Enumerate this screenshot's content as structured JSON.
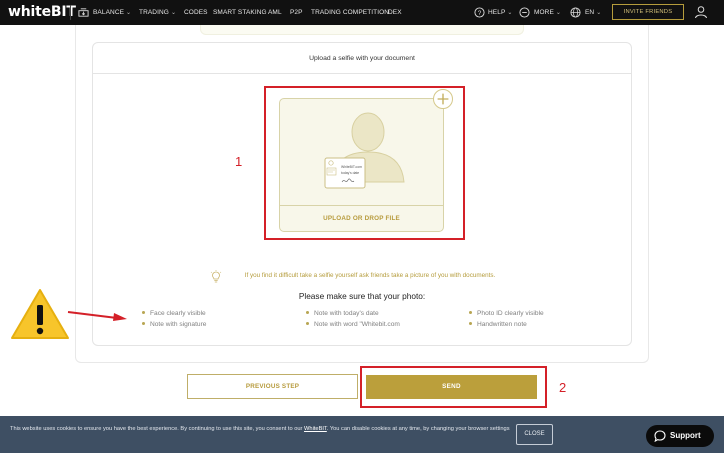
{
  "nav": {
    "logo_white": "white",
    "logo_bit": "BIT",
    "balance": "BALANCE",
    "trading": "TRADING",
    "codes": "CODES",
    "smart_staking": "SMART STAKING",
    "aml": "AML",
    "p2p": "P2P",
    "trading_competition": "TRADING COMPETITION",
    "dex": "DEX",
    "help": "HELP",
    "more": "MORE",
    "language": "EN",
    "invite": "INVITE FRIENDS"
  },
  "upload": {
    "header": "Upload a selfie with your document",
    "drop_label": "UPLOAD OR DROP FILE",
    "card_line1": "WhiteBIT.com",
    "card_line2": "today's date",
    "card_sign": "signature"
  },
  "annotations": {
    "marker1": "1",
    "marker2": "2"
  },
  "tip": "If you find it difficult take a selfie yourself ask friends take a picture of you with documents.",
  "make_sure": "Please make sure that your photo:",
  "requirements": {
    "col1": [
      "Face clearly visible",
      "Note with signature"
    ],
    "col2": [
      "Note with today's date",
      "Note with word \"Whitebit.com"
    ],
    "col3": [
      "Photo ID clearly visible",
      "Handwritten note"
    ]
  },
  "buttons": {
    "previous": "PREVIOUS STEP",
    "send": "SEND"
  },
  "cookie": {
    "text_before": "This website uses cookies to ensure you have the best experience. By continuing to use this site, you consent to our ",
    "link": "WhiteBIT",
    "text_after": ". You can disable cookies at any time, by changing your browser settings",
    "close": "CLOSE"
  },
  "support": "Support",
  "colors": {
    "accent_gold": "#bb9f3b",
    "annotation_red": "#d42028",
    "nav_bg": "#111111",
    "cookie_bg": "#3e4f63"
  }
}
